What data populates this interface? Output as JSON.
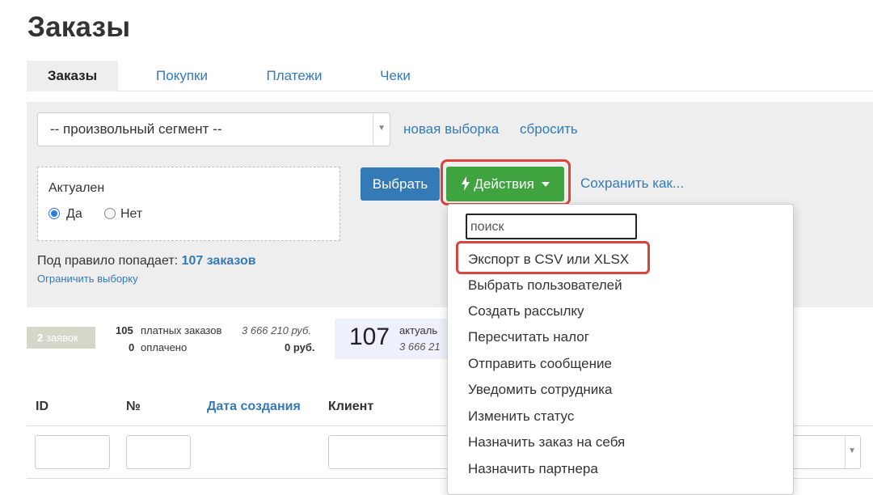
{
  "page": {
    "title": "Заказы"
  },
  "tabs": [
    "Заказы",
    "Покупки",
    "Платежи",
    "Чеки"
  ],
  "filter": {
    "segment_value": "-- произвольный сегмент --",
    "new_selection": "новая выборка",
    "reset": "сбросить",
    "condition_label": "Актуален",
    "option_yes": "Да",
    "option_no": "Нет",
    "select_button": "Выбрать",
    "actions_button": "Действия",
    "save_as": "Сохранить как...",
    "rule_prefix": "Под правило попадает:",
    "rule_count": "107 заказов",
    "limit_link": "Ограничить выборку"
  },
  "stats": {
    "badge_num": "2",
    "badge_text": "заявок",
    "paid_count": "105",
    "paid_label": "платных заказов",
    "paid_sum": "3 666 210 руб.",
    "settled_count": "0",
    "settled_label": "оплачено",
    "settled_sum": "0 руб.",
    "actual_num": "107",
    "actual_label": "актуаль",
    "actual_sum": "3 666 21"
  },
  "table": {
    "columns": [
      "ID",
      "№",
      "Дата создания",
      "Клиент"
    ]
  },
  "menu": {
    "search_placeholder": "поиск",
    "items": [
      "Экспорт в CSV или XLSX",
      "Выбрать пользователей",
      "Создать рассылку",
      "Пересчитать налог",
      "Отправить сообщение",
      "Уведомить сотрудника",
      "Изменить статус",
      "Назначить заказ на себя",
      "Назначить партнера"
    ]
  },
  "colors": {
    "link": "#337ab7",
    "primary_button": "#337ab7",
    "success_button": "#3fa33f",
    "highlight_outline": "#d9443b"
  },
  "icons": {
    "actions_icon": "lightning-bolt-icon",
    "actions_caret": "caret-down-icon"
  }
}
